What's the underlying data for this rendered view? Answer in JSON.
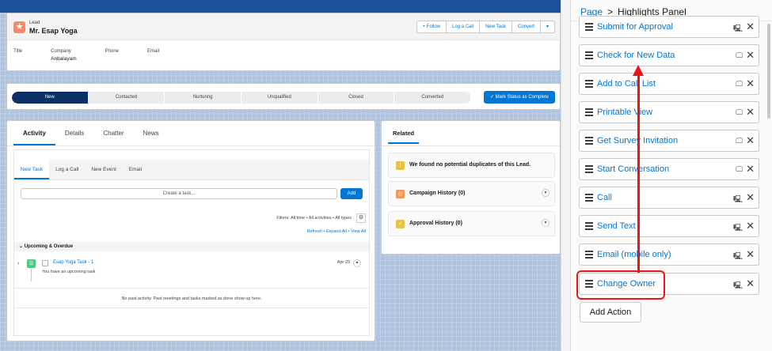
{
  "record": {
    "type_label": "Lead",
    "name": "Mr. Esap Yoga",
    "actions": [
      "+ Follow",
      "Log a Call",
      "New Task",
      "Convert",
      "▾"
    ],
    "fields": [
      {
        "label": "Title",
        "value": ""
      },
      {
        "label": "Company",
        "value": "Anbalayam"
      },
      {
        "label": "Phone",
        "value": ""
      },
      {
        "label": "Email",
        "value": ""
      }
    ]
  },
  "path": {
    "steps": [
      "New",
      "Contacted",
      "Nurturing",
      "Unqualified",
      "Closed",
      "Converted"
    ],
    "active_index": 0,
    "mark_button": "✓ Mark Status as Complete"
  },
  "activity": {
    "tabs": [
      "Activity",
      "Details",
      "Chatter",
      "News"
    ],
    "subtabs": [
      "New Task",
      "Log a Call",
      "New Event",
      "Email"
    ],
    "task_placeholder": "Create a task...",
    "add_label": "Add",
    "filters": "Filters: All time • All activities • All types",
    "links": "Refresh • Expand All • View All",
    "upcoming_label": "Upcoming & Overdue",
    "task": {
      "title": "Esap Yoga Task - 1",
      "subtitle": "You have an upcoming task",
      "date": "Apr 29"
    },
    "no_past": "No past activity. Past meetings and tasks marked as done show up here."
  },
  "related": {
    "title": "Related",
    "items": [
      {
        "text": "We found no potential duplicates of this Lead.",
        "icon_color": "#e5c34a",
        "icon": "!"
      },
      {
        "text": "Campaign History (0)",
        "icon_color": "#f49756",
        "icon": "◎"
      },
      {
        "text": "Approval History (0)",
        "icon_color": "#e5c34a",
        "icon": "✓"
      }
    ]
  },
  "panel": {
    "breadcrumb_page": "Page",
    "breadcrumb_sep": ">",
    "breadcrumb_current": "Highlights Panel",
    "actions": [
      {
        "label": "Submit for Approval",
        "device": "mobile-desktop-icon"
      },
      {
        "label": "Check for New Data",
        "device": "desktop-icon"
      },
      {
        "label": "Add to Call List",
        "device": "desktop-icon"
      },
      {
        "label": "Printable View",
        "device": "desktop-icon"
      },
      {
        "label": "Get Survey Invitation",
        "device": "desktop-icon"
      },
      {
        "label": "Start Conversation",
        "device": "desktop-icon"
      },
      {
        "label": "Call",
        "device": "mobile-desktop-icon"
      },
      {
        "label": "Send Text",
        "device": "mobile-desktop-icon"
      },
      {
        "label": "Email (mobile only)",
        "device": "mobile-desktop-icon"
      },
      {
        "label": "Change Owner",
        "device": "mobile-desktop-icon"
      }
    ],
    "add_action": "Add Action"
  },
  "colors": {
    "brand": "#0176d3",
    "annotation": "#e8161b",
    "path_active": "#0b2f66"
  }
}
